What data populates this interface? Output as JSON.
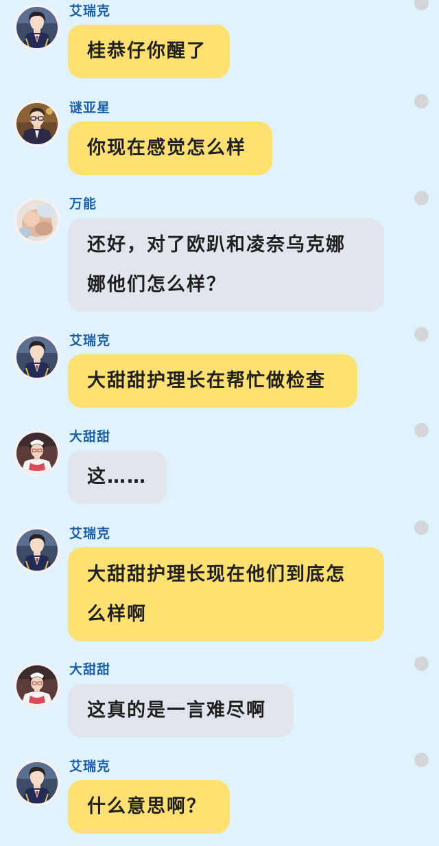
{
  "messages": [
    {
      "sender": "艾瑞克",
      "avatar": "eric",
      "text": "桂恭仔你醒了",
      "bubble": "yellow"
    },
    {
      "sender": "谜亚星",
      "avatar": "miyaxing",
      "text": "你现在感觉怎么样",
      "bubble": "yellow"
    },
    {
      "sender": "万能",
      "avatar": "wanneng",
      "text": "还好，对了欧趴和凌奈乌克娜娜他们怎么样？",
      "bubble": "grey"
    },
    {
      "sender": "艾瑞克",
      "avatar": "eric",
      "text": "大甜甜护理长在帮忙做检查",
      "bubble": "yellow"
    },
    {
      "sender": "大甜甜",
      "avatar": "datiantian",
      "text": "这……",
      "bubble": "grey"
    },
    {
      "sender": "艾瑞克",
      "avatar": "eric",
      "text": "大甜甜护理长现在他们到底怎么样啊",
      "bubble": "yellow"
    },
    {
      "sender": "大甜甜",
      "avatar": "datiantian",
      "text": "这真的是一言难尽啊",
      "bubble": "grey"
    },
    {
      "sender": "艾瑞克",
      "avatar": "eric",
      "text": "什么意思啊？",
      "bubble": "yellow"
    }
  ],
  "colors": {
    "background": "#e0f3fd",
    "yellow_bubble": "#ffe072",
    "grey_bubble": "#e1e6ee",
    "sender_name": "#1b5fa6",
    "dot": "#d3d5d8"
  },
  "icons": {
    "eric": "boy-in-uniform-avatar",
    "miyaxing": "boy-with-glasses-avatar",
    "wanneng": "blurred-photo-avatar",
    "datiantian": "nurse-avatar"
  }
}
